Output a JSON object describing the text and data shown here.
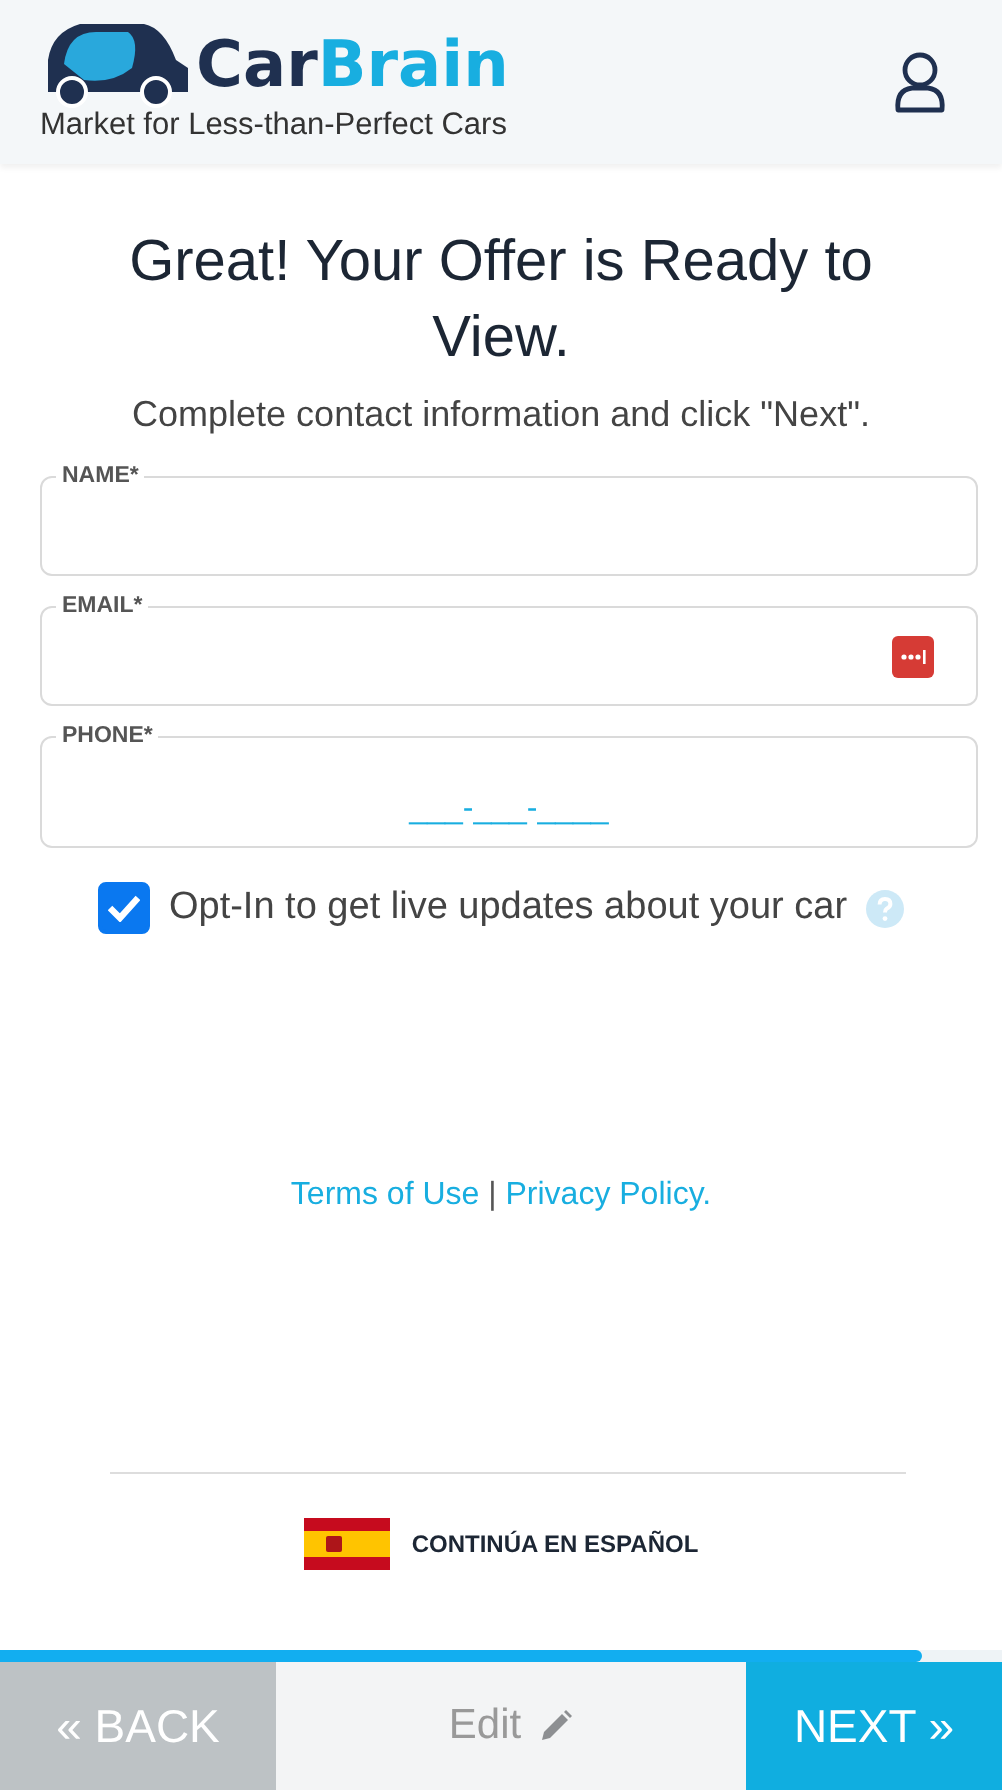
{
  "header": {
    "logo_word_1": "Car",
    "logo_word_2": "Brain",
    "tagline": "Market for Less-than-Perfect Cars"
  },
  "title": "Great! Your Offer is Ready to View.",
  "subtitle": "Complete contact information and click \"Next\".",
  "fields": [
    {
      "kind": "text",
      "label": "NAME*"
    },
    {
      "kind": "email",
      "label": "EMAIL*"
    },
    {
      "kind": "phone",
      "label": "PHONE*",
      "placeholder": "___-___-____"
    }
  ],
  "opt_in": {
    "label": "Opt-In to get live updates about your car",
    "checked": true
  },
  "legal": {
    "terms": "Terms of Use",
    "separator": "|",
    "privacy": "Privacy Policy."
  },
  "language_link": "CONTINÚA EN ESPAÑOL",
  "progress": {
    "level": 0.92
  },
  "footer": {
    "back": {
      "arrow": "«",
      "label": "BACK"
    },
    "edit": "Edit",
    "next": {
      "label": "NEXT",
      "arrow": "»"
    }
  }
}
